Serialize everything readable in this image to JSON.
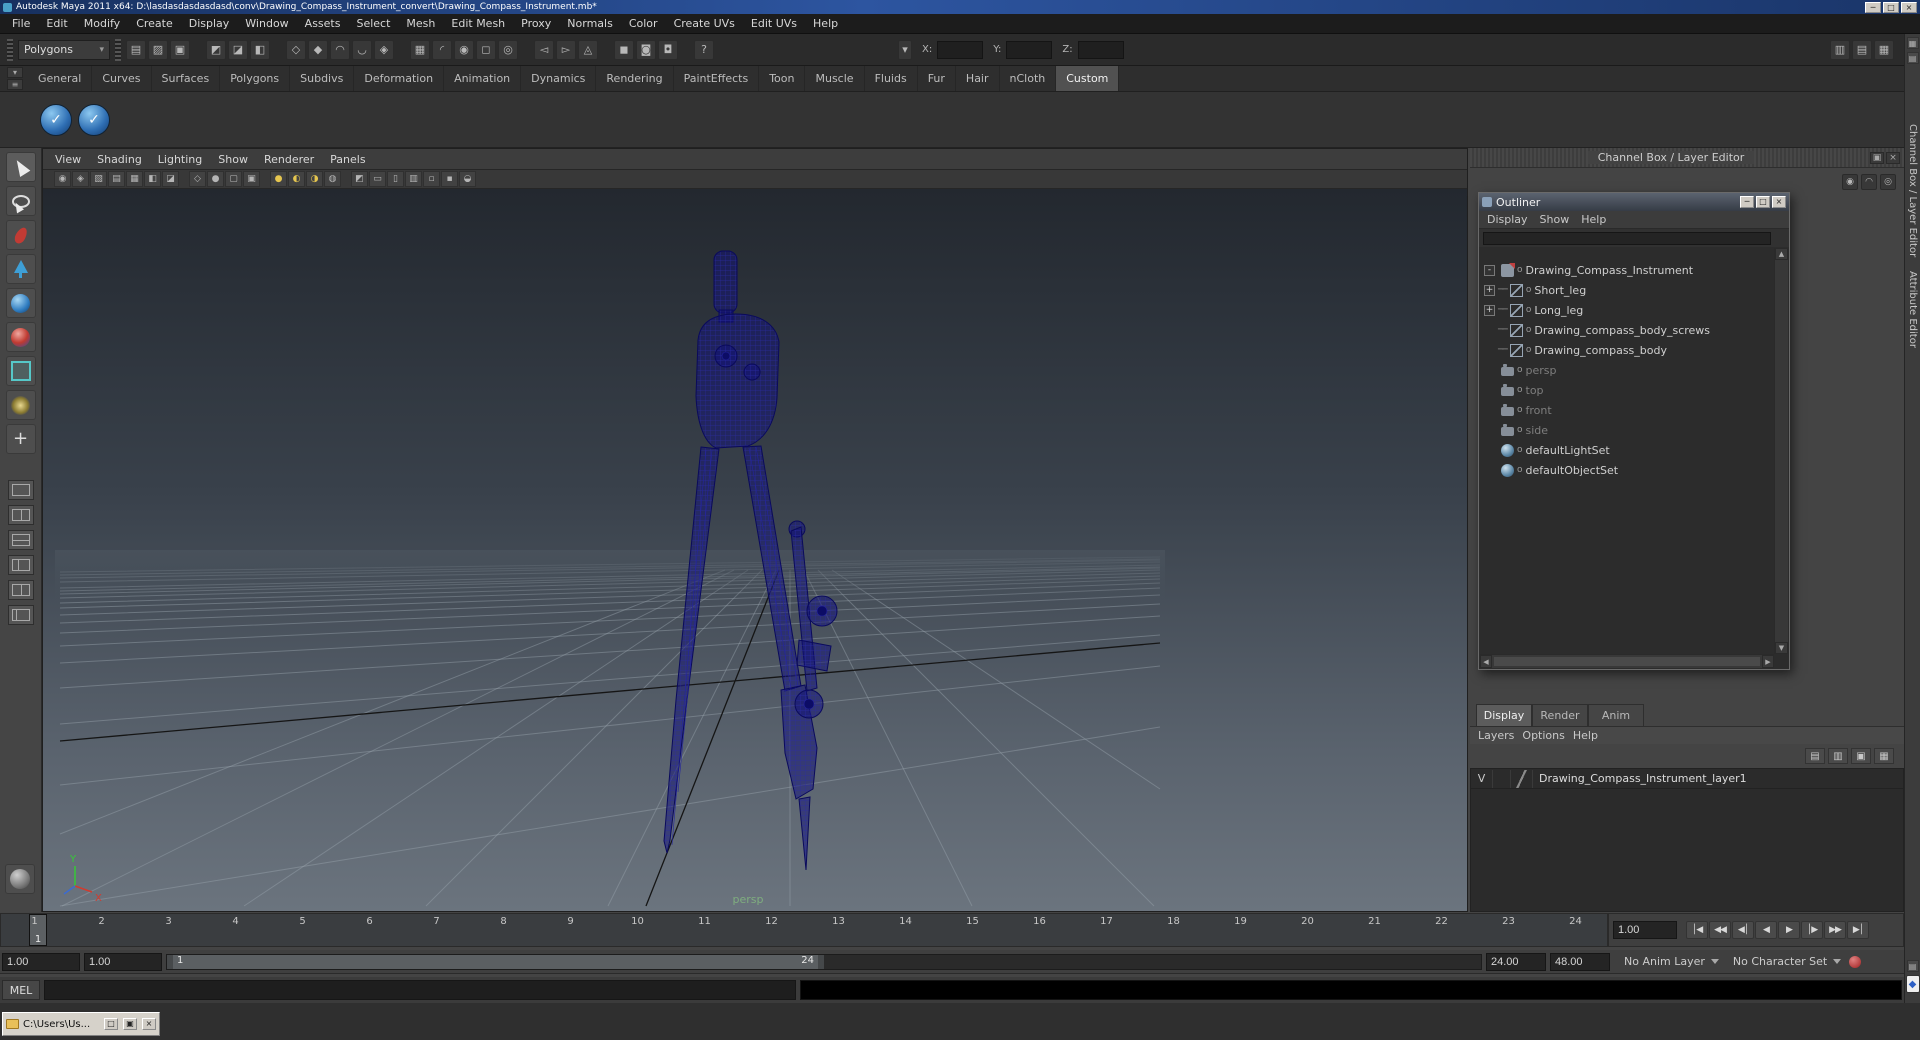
{
  "window": {
    "title": "Autodesk Maya 2011 x64: D:\\lasdasdasdasdasd\\conv\\Drawing_Compass_Instrument_convert\\Drawing_Compass_Instrument.mb*",
    "controls": {
      "minimize": "─",
      "maximize": "□",
      "close": "×"
    }
  },
  "menu_bar": {
    "items": [
      "File",
      "Edit",
      "Modify",
      "Create",
      "Display",
      "Window",
      "Assets",
      "Select",
      "Mesh",
      "Edit Mesh",
      "Proxy",
      "Normals",
      "Color",
      "Create UVs",
      "Edit UVs",
      "Help"
    ]
  },
  "status_line": {
    "mode_dropdown": "Polygons",
    "dropdown_arrow": "▾",
    "icons": [
      {
        "name": "new-scene-icon",
        "glyph": "▤"
      },
      {
        "name": "open-scene-icon",
        "glyph": "▨"
      },
      {
        "name": "save-scene-icon",
        "glyph": "▣"
      },
      {
        "name": "select-hierarchy-icon",
        "glyph": "◩",
        "sep": true
      },
      {
        "name": "select-object-icon",
        "glyph": "◪"
      },
      {
        "name": "select-component-icon",
        "glyph": "◧"
      },
      {
        "name": "mask-handles-icon",
        "glyph": "◇",
        "sep": true
      },
      {
        "name": "mask-joints-icon",
        "glyph": "◆"
      },
      {
        "name": "mask-curves-icon",
        "glyph": "◠"
      },
      {
        "name": "mask-surfaces-icon",
        "glyph": "◡"
      },
      {
        "name": "mask-deformers-icon",
        "glyph": "◈"
      },
      {
        "name": "snap-grid-icon",
        "glyph": "▦",
        "sep": true
      },
      {
        "name": "snap-curve-icon",
        "glyph": "◜"
      },
      {
        "name": "snap-point-icon",
        "glyph": "◉"
      },
      {
        "name": "snap-plane-icon",
        "glyph": "◻"
      },
      {
        "name": "snap-view-icon",
        "glyph": "◎"
      },
      {
        "name": "input-connections-icon",
        "glyph": "◅",
        "sep": true
      },
      {
        "name": "output-connections-icon",
        "glyph": "▻"
      },
      {
        "name": "construction-history-icon",
        "glyph": "◬"
      },
      {
        "name": "render-frame-icon",
        "glyph": "◼",
        "sep": true
      },
      {
        "name": "ipr-render-icon",
        "glyph": "◙"
      },
      {
        "name": "render-settings-icon",
        "glyph": "◘"
      },
      {
        "name": "help-line-icon",
        "glyph": "?",
        "sep": true
      }
    ],
    "coords": {
      "toggle_glyph": "▾",
      "x_label": "X:",
      "y_label": "Y:",
      "z_label": "Z:",
      "x_value": "",
      "y_value": "",
      "z_value": ""
    },
    "right_icons": [
      {
        "name": "show-attribute-editor-icon",
        "glyph": "▥"
      },
      {
        "name": "show-tool-settings-icon",
        "glyph": "▤"
      },
      {
        "name": "show-channel-box-icon",
        "glyph": "▦"
      }
    ]
  },
  "shelf": {
    "tab_arrow": "▾",
    "menu_glyph": "≡",
    "tabs": [
      {
        "label": "General",
        "active": false
      },
      {
        "label": "Curves",
        "active": false
      },
      {
        "label": "Surfaces",
        "active": false
      },
      {
        "label": "Polygons",
        "active": false
      },
      {
        "label": "Subdivs",
        "active": false
      },
      {
        "label": "Deformation",
        "active": false
      },
      {
        "label": "Animation",
        "active": false
      },
      {
        "label": "Dynamics",
        "active": false
      },
      {
        "label": "Rendering",
        "active": false
      },
      {
        "label": "PaintEffects",
        "active": false
      },
      {
        "label": "Toon",
        "active": false
      },
      {
        "label": "Muscle",
        "active": false
      },
      {
        "label": "Fluids",
        "active": false
      },
      {
        "label": "Fur",
        "active": false
      },
      {
        "label": "Hair",
        "active": false
      },
      {
        "label": "nCloth",
        "active": false
      },
      {
        "label": "Custom",
        "active": true
      }
    ],
    "buttons": [
      {
        "name": "custom-shelf-button-1",
        "glyph": "✓"
      },
      {
        "name": "custom-shelf-button-2",
        "glyph": "✓"
      }
    ]
  },
  "toolbox": {
    "tools": [
      "select",
      "lasso-select",
      "paint-select",
      "move",
      "rotate",
      "scale",
      "universal-manipulator",
      "soft-modification",
      "show-manipulator"
    ],
    "layouts": [
      "single-pane",
      "two-panes-side",
      "two-panes-stacked",
      "three-panes",
      "four-panes",
      "persp-outliner"
    ]
  },
  "viewport": {
    "menus": [
      "View",
      "Shading",
      "Lighting",
      "Show",
      "Renderer",
      "Panels"
    ],
    "toolbar_icons": [
      {
        "name": "select-camera-icon",
        "glyph": "◉"
      },
      {
        "name": "lock-camera-icon",
        "glyph": "◈"
      },
      {
        "name": "camera-attributes-icon",
        "glyph": "▧"
      },
      {
        "name": "bookmarks-icon",
        "glyph": "▤"
      },
      {
        "name": "image-plane-icon",
        "glyph": "▦"
      },
      {
        "name": "two-d-pan-zoom-icon",
        "glyph": "◧"
      },
      {
        "name": "grease-pencil-icon",
        "glyph": "◪"
      },
      {
        "name": "wireframe-mode-icon",
        "glyph": "◇",
        "sep": true
      },
      {
        "name": "smooth-shade-mode-icon",
        "glyph": "●"
      },
      {
        "name": "bounding-box-mode-icon",
        "glyph": "▢"
      },
      {
        "name": "textured-mode-icon",
        "glyph": "▣"
      },
      {
        "name": "use-default-lighting-icon",
        "glyph": "●",
        "tone": "warm",
        "sep": true
      },
      {
        "name": "use-all-lights-icon",
        "glyph": "◐",
        "tone": "warm"
      },
      {
        "name": "shadows-icon",
        "glyph": "◑",
        "tone": "warm"
      },
      {
        "name": "xray-mode-icon",
        "glyph": "◍"
      },
      {
        "name": "isolate-select-icon",
        "glyph": "◩",
        "sep": true
      },
      {
        "name": "resolution-gate-icon",
        "glyph": "▭"
      },
      {
        "name": "film-gate-icon",
        "glyph": "▯"
      },
      {
        "name": "field-chart-icon",
        "glyph": "▥"
      },
      {
        "name": "safe-action-icon",
        "glyph": "▫"
      },
      {
        "name": "safe-title-icon",
        "glyph": "▪"
      },
      {
        "name": "multi-sample-icon",
        "glyph": "◒"
      }
    ],
    "camera_label": "persp",
    "axis": {
      "x": "X",
      "y": "Y"
    }
  },
  "channel_box": {
    "header": "Channel Box / Layer Editor",
    "header_icons": [
      {
        "name": "dock-panel-icon",
        "glyph": "▣"
      },
      {
        "name": "close-panel-icon",
        "glyph": "×"
      }
    ],
    "tool_icons": [
      {
        "name": "speed-slider-icon",
        "glyph": "◉"
      },
      {
        "name": "hyperbolic-slider-icon",
        "glyph": "◠"
      },
      {
        "name": "manipulator-link-icon",
        "glyph": "◎"
      }
    ]
  },
  "right_strip": {
    "top_icons": [
      {
        "name": "toggle-ui-elements-icon",
        "glyph": "▦"
      },
      {
        "name": "toggle-panel-layout-icon",
        "glyph": "▤"
      }
    ],
    "tabs": [
      "Channel Box / Layer Editor",
      "Attribute Editor"
    ],
    "bottom_icons": [
      {
        "name": "raise-window-icon",
        "glyph": "▤"
      },
      {
        "name": "script-editor-icon",
        "glyph": "◆"
      }
    ]
  },
  "outliner": {
    "title": "Outliner",
    "controls": {
      "minimize": "─",
      "maximize": "□",
      "close": "×"
    },
    "menus": [
      "Display",
      "Show",
      "Help"
    ],
    "filter_value": "",
    "items": [
      {
        "label": "Drawing_Compass_Instrument",
        "icon": "transform",
        "expander": "-",
        "conn": "",
        "dimmed": false
      },
      {
        "label": "Short_leg",
        "icon": "mesh",
        "expander": "+",
        "conn": "──",
        "dimmed": false
      },
      {
        "label": "Long_leg",
        "icon": "mesh",
        "expander": "+",
        "conn": "──",
        "dimmed": false
      },
      {
        "label": "Drawing_compass_body_screws",
        "icon": "mesh",
        "expander": "",
        "conn": "──",
        "dimmed": false
      },
      {
        "label": "Drawing_compass_body",
        "icon": "mesh",
        "expander": "",
        "conn": "──",
        "dimmed": false
      },
      {
        "label": "persp",
        "icon": "camera",
        "expander": "",
        "conn": "",
        "dimmed": true
      },
      {
        "label": "top",
        "icon": "camera",
        "expander": "",
        "conn": "",
        "dimmed": true
      },
      {
        "label": "front",
        "icon": "camera",
        "expander": "",
        "conn": "",
        "dimmed": true
      },
      {
        "label": "side",
        "icon": "camera",
        "expander": "",
        "conn": "",
        "dimmed": true
      },
      {
        "label": "defaultLightSet",
        "icon": "set",
        "expander": "",
        "conn": "",
        "dimmed": false
      },
      {
        "label": "defaultObjectSet",
        "icon": "set",
        "expander": "",
        "conn": "",
        "dimmed": false
      }
    ]
  },
  "layer_editor": {
    "tabs": [
      {
        "label": "Display",
        "active": true
      },
      {
        "label": "Render",
        "active": false
      },
      {
        "label": "Anim",
        "active": false
      }
    ],
    "menus": [
      "Layers",
      "Options",
      "Help"
    ],
    "toolbar_icons": [
      {
        "name": "layer-move-up-icon",
        "glyph": "▤"
      },
      {
        "name": "layer-move-down-icon",
        "glyph": "▥"
      },
      {
        "name": "new-empty-layer-icon",
        "glyph": "▣"
      },
      {
        "name": "new-layer-from-selected-icon",
        "glyph": "▦"
      }
    ],
    "layers": [
      {
        "visibility": "V",
        "name": "Drawing_Compass_Instrument_layer1"
      }
    ]
  },
  "time_slider": {
    "ticks": [
      "1",
      "2",
      "3",
      "4",
      "5",
      "6",
      "7",
      "8",
      "9",
      "10",
      "11",
      "12",
      "13",
      "14",
      "15",
      "16",
      "17",
      "18",
      "19",
      "20",
      "21",
      "22",
      "23",
      "24"
    ],
    "current_frame": "1",
    "current_time": "1.00",
    "transport": [
      {
        "name": "go-to-start-button",
        "glyph": "│◀"
      },
      {
        "name": "step-back-frame-button",
        "glyph": "◀◀"
      },
      {
        "name": "step-back-key-button",
        "glyph": "◀│"
      },
      {
        "name": "play-backward-button",
        "glyph": "◀"
      },
      {
        "name": "play-forward-button",
        "glyph": "▶"
      },
      {
        "name": "step-forward-key-button",
        "glyph": "│▶"
      },
      {
        "name": "step-forward-frame-button",
        "glyph": "▶▶"
      },
      {
        "name": "go-to-end-button",
        "glyph": "▶│"
      }
    ]
  },
  "range_slider": {
    "animation_start": "1.00",
    "playback_start": "1.00",
    "range_start_label": "1",
    "range_end_label": "24",
    "playback_end": "24.00",
    "animation_end": "48.00",
    "anim_layer": "No Anim Layer",
    "character_set": "No Character Set"
  },
  "command_line": {
    "label": "MEL",
    "input_value": ""
  },
  "taskbar": {
    "window_title": "C:\\Users\\Us...",
    "controls": {
      "restore": "□",
      "maximize": "▣",
      "close": "×"
    }
  }
}
